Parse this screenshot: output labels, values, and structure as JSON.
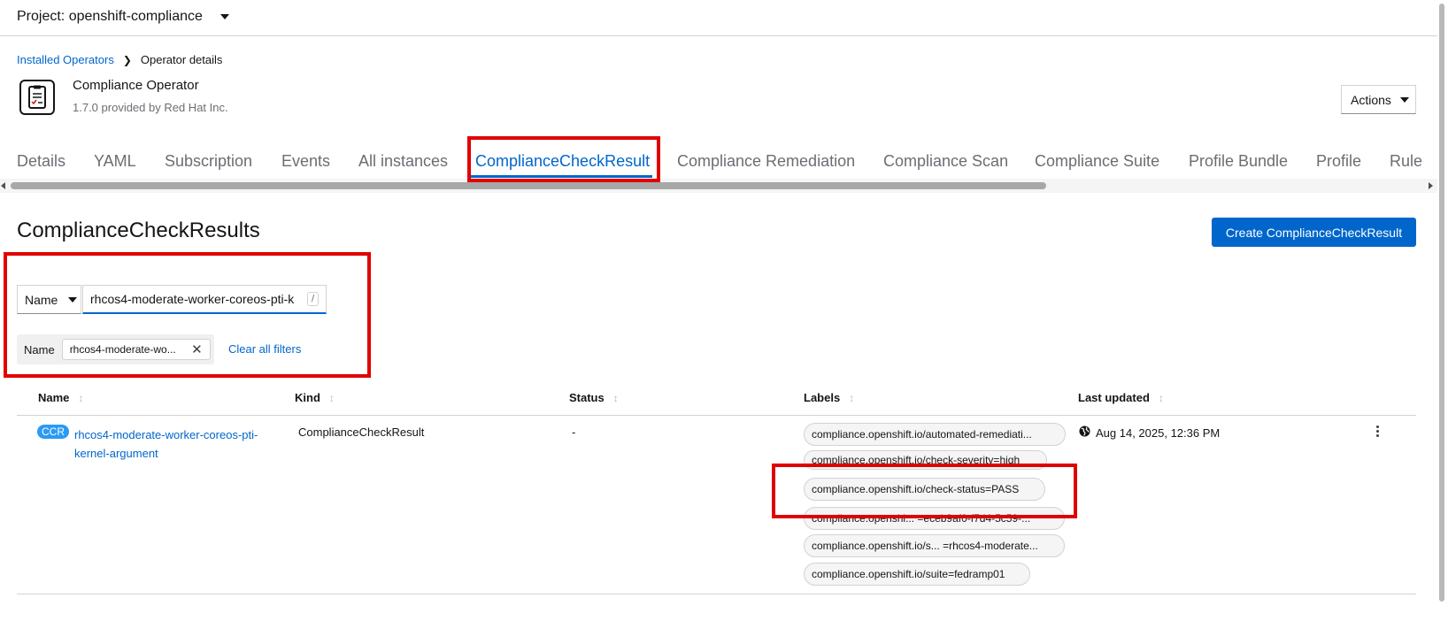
{
  "project": {
    "label": "Project: openshift-compliance"
  },
  "breadcrumb": {
    "parent": "Installed Operators",
    "current": "Operator details"
  },
  "operator": {
    "title": "Compliance Operator",
    "subtitle": "1.7.0 provided by Red Hat Inc."
  },
  "actions": {
    "label": "Actions"
  },
  "tabs": [
    {
      "label": "Details"
    },
    {
      "label": "YAML"
    },
    {
      "label": "Subscription"
    },
    {
      "label": "Events"
    },
    {
      "label": "All instances"
    },
    {
      "label": "ComplianceCheckResult"
    },
    {
      "label": "Compliance Remediation"
    },
    {
      "label": "Compliance Scan"
    },
    {
      "label": "Compliance Suite"
    },
    {
      "label": "Profile Bundle"
    },
    {
      "label": "Profile"
    },
    {
      "label": "Rule"
    }
  ],
  "page": {
    "title": "ComplianceCheckResults",
    "create_label": "Create ComplianceCheckResult"
  },
  "filter": {
    "type_label": "Name",
    "value": "rhcos4-moderate-worker-coreos-pti-k",
    "shortcut": "/",
    "chip_category": "Name",
    "chip_value": "rhcos4-moderate-wo...",
    "clear_all": "Clear all filters"
  },
  "table": {
    "headers": {
      "name": "Name",
      "kind": "Kind",
      "status": "Status",
      "labels": "Labels",
      "updated": "Last updated"
    },
    "row": {
      "badge": "CCR",
      "name": "rhcos4-moderate-worker-coreos-pti-kernel-argument",
      "kind": "ComplianceCheckResult",
      "status": "-",
      "labels": [
        "compliance.openshift.io/automated-remediati...",
        "compliance.openshift.io/check-severity=high",
        "compliance.openshift.io/check-status=PASS",
        "compliance.openshi... =eceb9af0-f7d4-5c59-...",
        "compliance.openshift.io/s... =rhcos4-moderate...",
        "compliance.openshift.io/suite=fedramp01"
      ],
      "updated": "Aug 14, 2025, 12:36 PM"
    }
  },
  "colors": {
    "accent": "#0066cc",
    "annotation": "#e00000"
  }
}
